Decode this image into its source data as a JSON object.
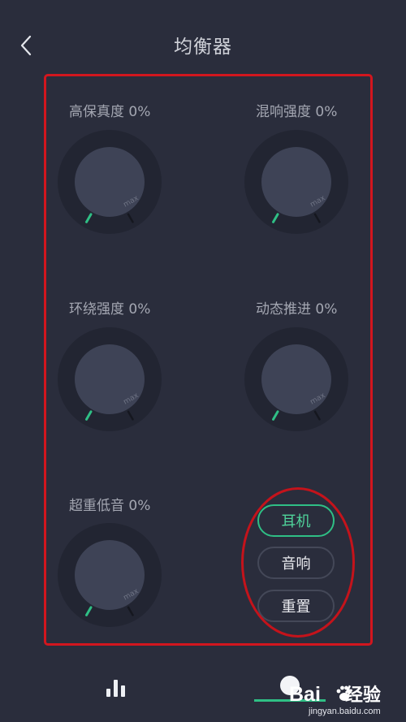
{
  "header": {
    "title": "均衡器",
    "back_icon": "chevron-left-icon"
  },
  "knobs": [
    {
      "label": "高保真度 0%",
      "value": 0
    },
    {
      "label": "混响强度 0%",
      "value": 0
    },
    {
      "label": "环绕强度 0%",
      "value": 0
    },
    {
      "label": "动态推进 0%",
      "value": 0
    },
    {
      "label": "超重低音 0%",
      "value": 0
    }
  ],
  "knob_max_text": "max",
  "modes": {
    "items": [
      "耳机",
      "音响",
      "重置"
    ],
    "selected": "耳机"
  },
  "bottom_nav": {
    "items": [
      "equalizer-icon",
      "circle-icon"
    ],
    "active_index": 1
  },
  "watermark": {
    "logo_left": "Bai",
    "logo_right": "经验",
    "url": "jingyan.baidu.com"
  },
  "colors": {
    "background": "#2a2d3c",
    "accent": "#2fbf85",
    "annotation_red": "#d2161e",
    "knob_ring": "#222532",
    "knob_face": "#3e4356"
  }
}
